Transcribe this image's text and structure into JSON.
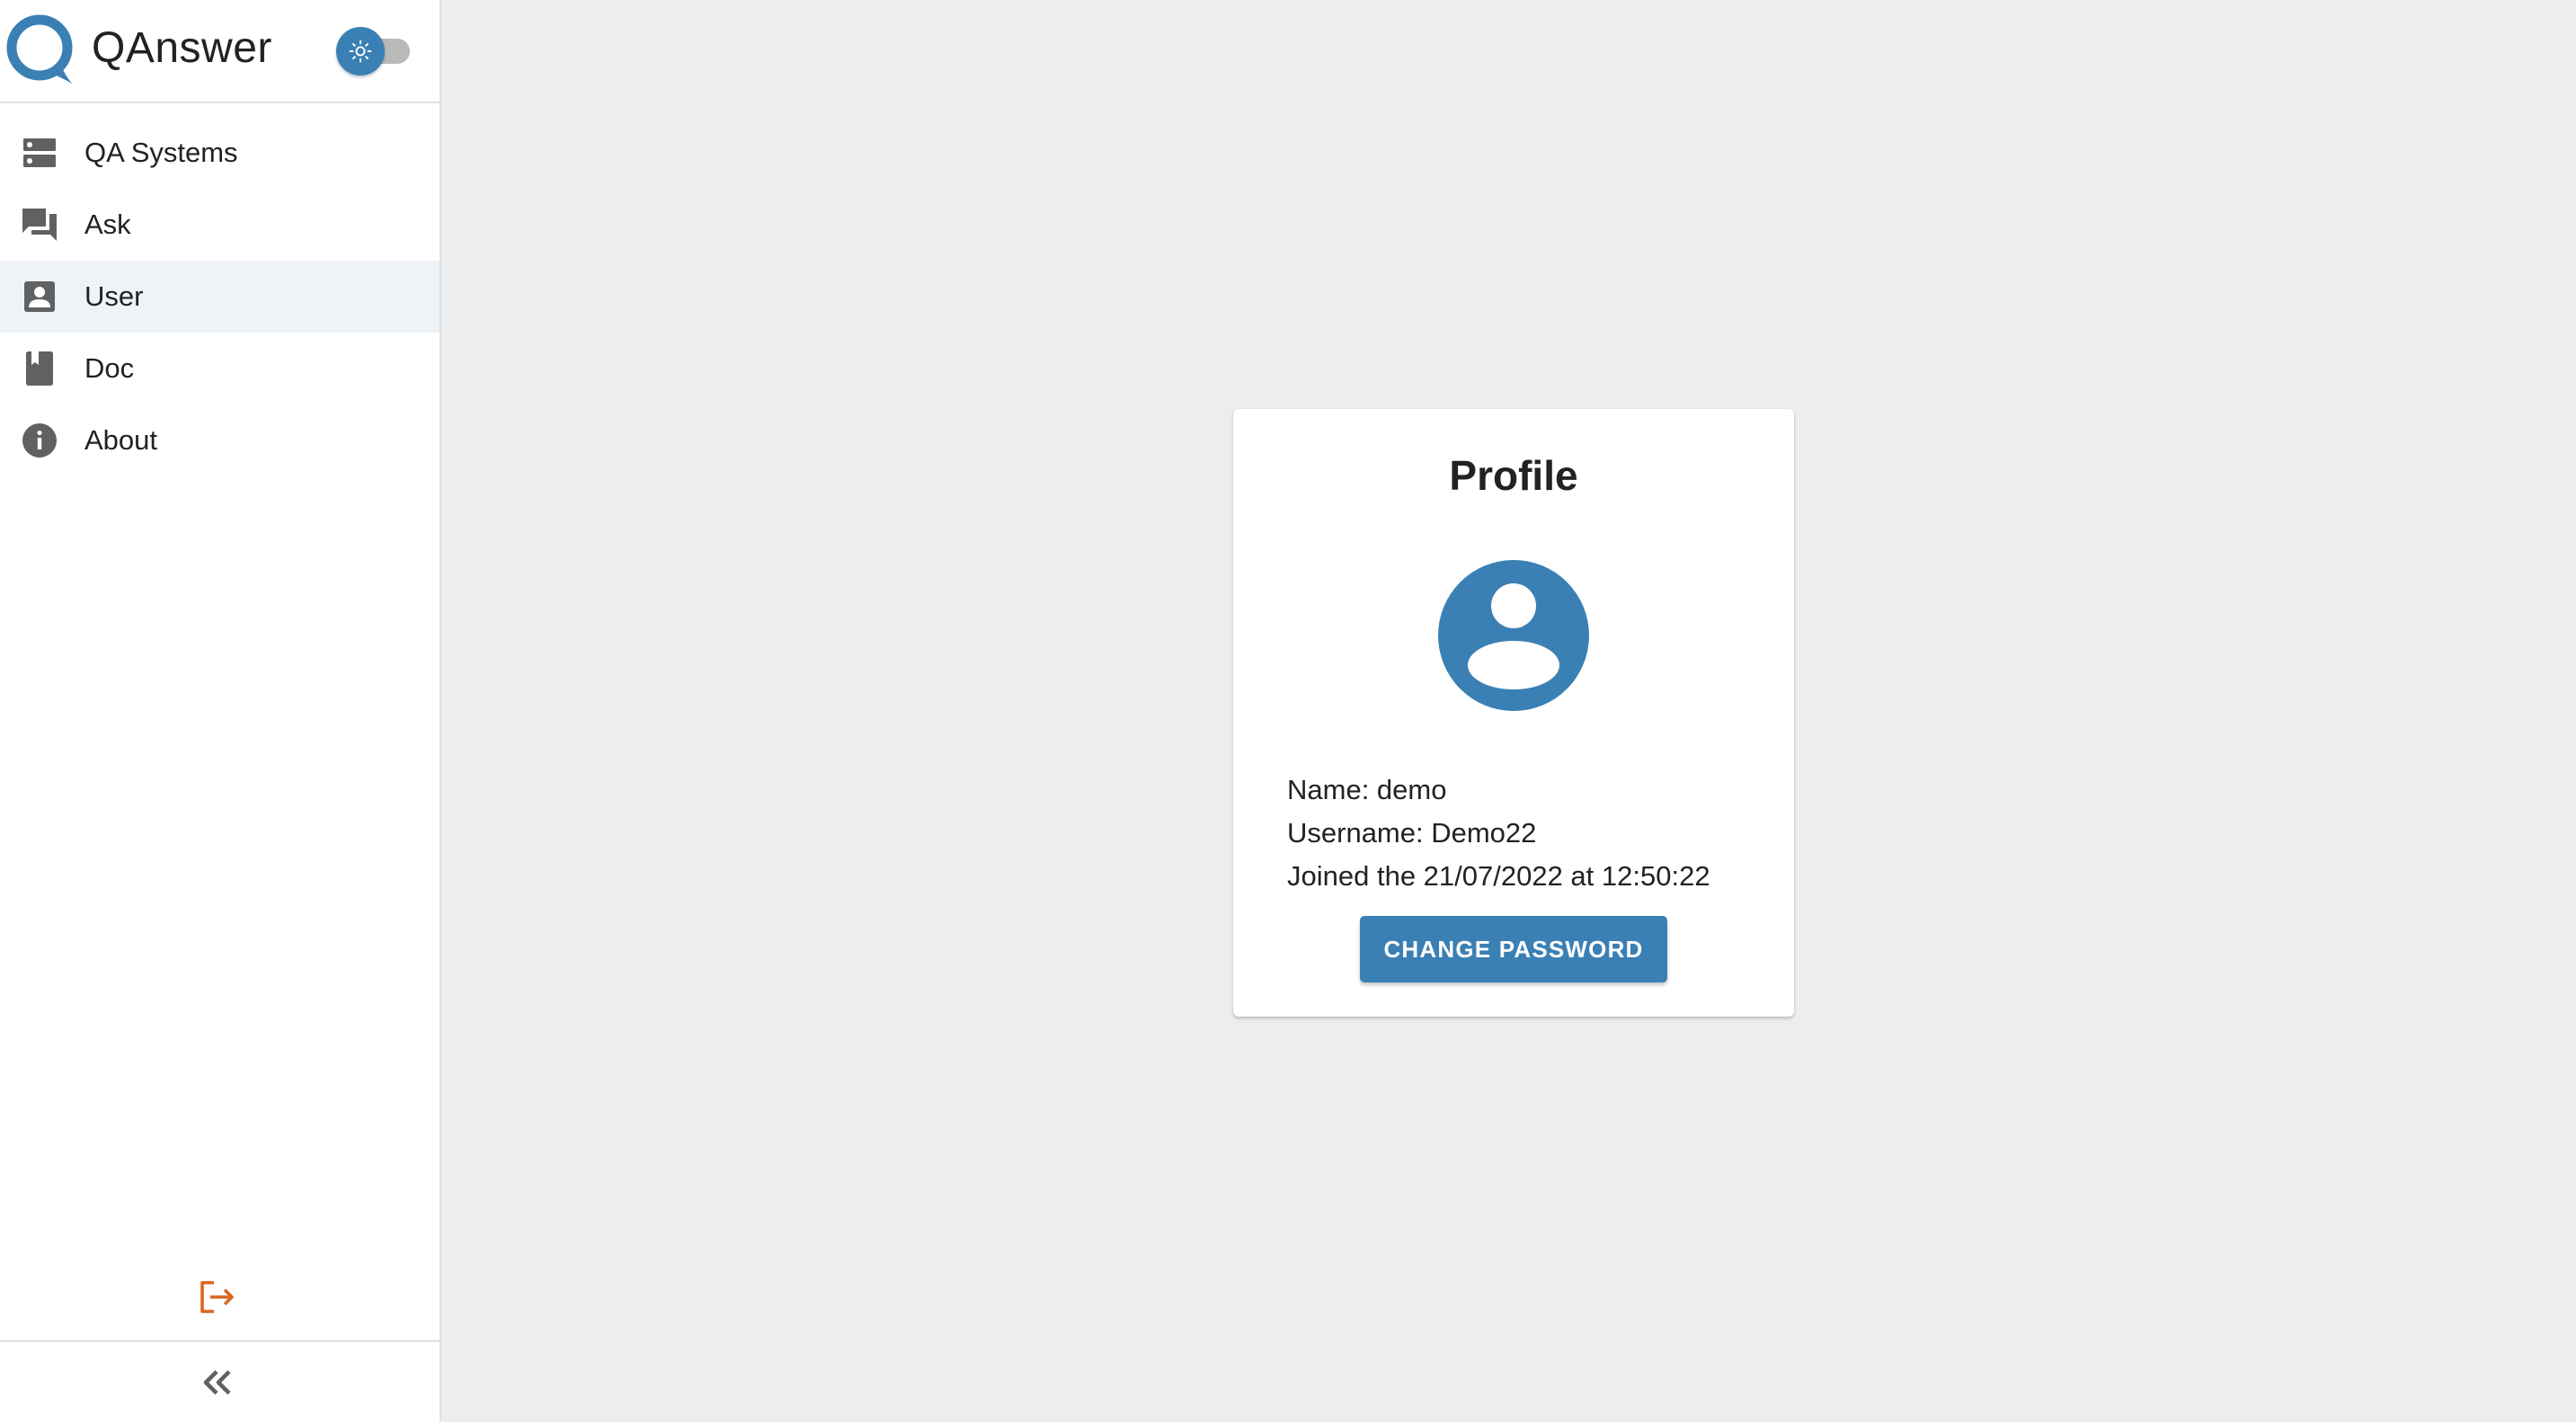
{
  "app": {
    "title": "QAnswer",
    "accent_color": "#3a80b4",
    "logout_color": "#d9651f",
    "theme_toggle": {
      "icon": "sun-icon",
      "state": "light"
    }
  },
  "sidebar": {
    "items": [
      {
        "label": "QA Systems",
        "icon": "dns-server-icon",
        "active": false
      },
      {
        "label": "Ask",
        "icon": "forum-chat-icon",
        "active": false
      },
      {
        "label": "User",
        "icon": "account-box-icon",
        "active": true
      },
      {
        "label": "Doc",
        "icon": "book-icon",
        "active": false
      },
      {
        "label": "About",
        "icon": "info-icon",
        "active": false
      }
    ],
    "logout_icon": "logout-icon",
    "collapse_icon": "double-chevron-left-icon"
  },
  "profile": {
    "title": "Profile",
    "avatar_icon": "account-circle-icon",
    "name_line": "Name: demo",
    "username_line": "Username: Demo22",
    "joined_line": "Joined the 21/07/2022 at 12:50:22",
    "change_password_label": "CHANGE PASSWORD"
  }
}
